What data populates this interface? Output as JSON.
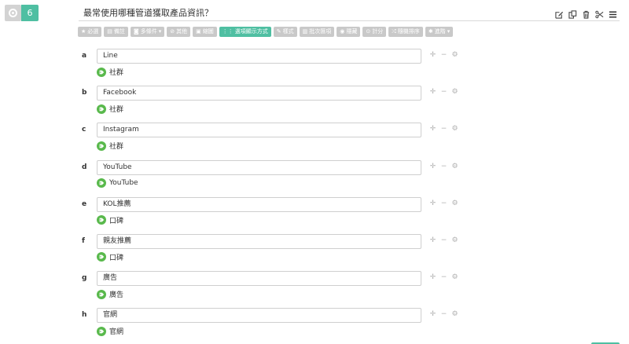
{
  "question": {
    "type_icon": "radio-icon",
    "number": "6",
    "title": "最常使用哪種管道獲取產品資訊？"
  },
  "header_tools": [
    {
      "name": "edit-icon"
    },
    {
      "name": "copy-icon"
    },
    {
      "name": "trash-icon"
    },
    {
      "name": "scissors-icon"
    },
    {
      "name": "menu-icon"
    }
  ],
  "toolbar": {
    "buttons": [
      {
        "icon": "★",
        "label": "必選",
        "active": false
      },
      {
        "icon": "▤",
        "label": "備註",
        "active": false
      },
      {
        "icon": "◙",
        "label": "多條件",
        "caret": "▾",
        "active": false
      },
      {
        "icon": "⊘",
        "label": "其他",
        "active": false
      },
      {
        "icon": "▣",
        "label": "縮圖",
        "active": false
      },
      {
        "icon": "⋮⋮",
        "label": "選項顯示方式",
        "active": true
      },
      {
        "icon": "✎",
        "label": "樣式",
        "active": false
      },
      {
        "icon": "▥",
        "label": "批次匯項",
        "active": false
      },
      {
        "icon": "◉",
        "label": "隱藏",
        "active": false
      },
      {
        "icon": "⊙",
        "label": "計分",
        "active": false
      },
      {
        "icon": "⤮",
        "label": "隨機排序",
        "active": false
      },
      {
        "icon": "✱",
        "label": "進階",
        "caret": "▾",
        "active": false
      }
    ]
  },
  "options": [
    {
      "letter": "a",
      "value": "Line",
      "tag": "社群"
    },
    {
      "letter": "b",
      "value": "Facebook",
      "tag": "社群"
    },
    {
      "letter": "c",
      "value": "Instagram",
      "tag": "社群"
    },
    {
      "letter": "d",
      "value": "YouTube",
      "tag": "YouTube"
    },
    {
      "letter": "e",
      "value": "KOL推薦",
      "tag": "口碑"
    },
    {
      "letter": "f",
      "value": "親友推薦",
      "tag": "口碑"
    },
    {
      "letter": "g",
      "value": "廣告",
      "tag": "廣告"
    },
    {
      "letter": "h",
      "value": "官網",
      "tag": "官網"
    }
  ],
  "option_controls": {
    "move": "✛",
    "remove": "−",
    "settings": "⚙"
  },
  "colors": {
    "accent": "#4fbfa2",
    "tag_green": "#59b94c",
    "muted": "#c9c9c9"
  }
}
